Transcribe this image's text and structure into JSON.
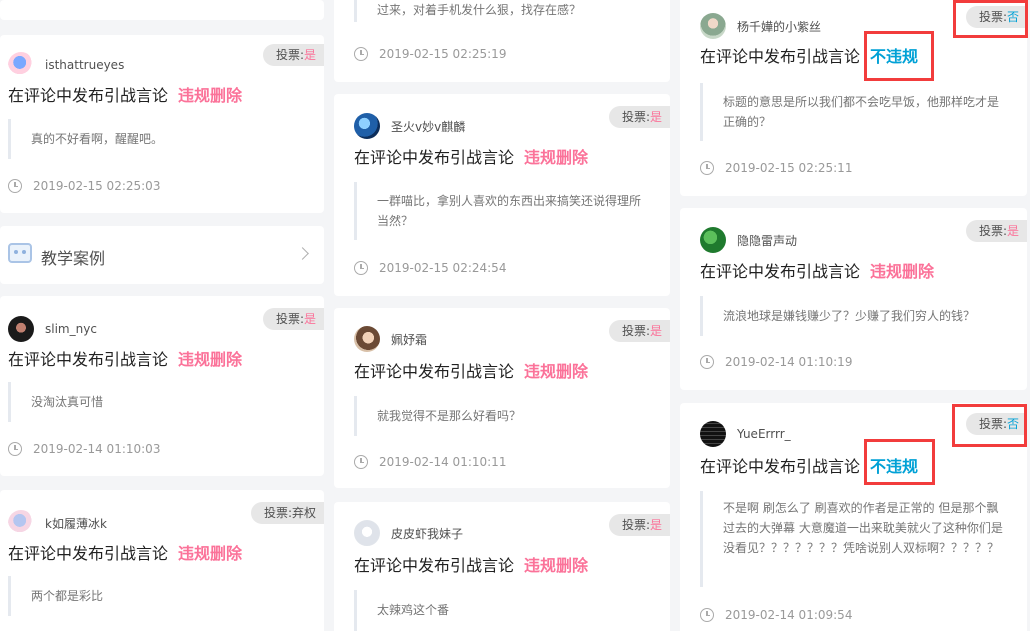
{
  "vote_prefix": "投票:",
  "menu": {
    "label": "教学案例"
  },
  "columns": [
    {
      "top_partial": {},
      "cards": [
        {
          "user": "isthattrueyes",
          "vote": "是",
          "reason": "在评论中发布引战言论",
          "verdict": "违规删除",
          "comment": "真的不好看啊，醒醒吧。",
          "time": "2019-02-15 02:25:03"
        },
        {
          "user": "slim_nyc",
          "vote": "是",
          "reason": "在评论中发布引战言论",
          "verdict": "违规删除",
          "comment": "没淘汰真可惜",
          "time": "2019-02-14 01:10:03"
        },
        {
          "user": "k如履薄冰k",
          "vote": "弃权",
          "reason": "在评论中发布引战言论",
          "verdict": "违规删除",
          "comment": "两个都是彩比",
          "time": ""
        }
      ]
    },
    {
      "top_partial": {
        "comment": "过来，对着手机发什么狠，找存在感？",
        "time": "2019-02-15 02:25:19"
      },
      "cards": [
        {
          "user": "圣火v妙v麒麟",
          "vote": "是",
          "reason": "在评论中发布引战言论",
          "verdict": "违规删除",
          "comment": "一群喵比，拿别人喜欢的东西出来搞笑还说得理所当然？",
          "time": "2019-02-15 02:24:54"
        },
        {
          "user": "姵妤霜",
          "vote": "是",
          "reason": "在评论中发布引战言论",
          "verdict": "违规删除",
          "comment": "就我觉得不是那么好看吗？",
          "time": "2019-02-14 01:10:11"
        },
        {
          "user": "皮皮虾我妹子",
          "vote": "是",
          "reason": "在评论中发布引战言论",
          "verdict": "违规删除",
          "comment": "太辣鸡这个番",
          "time": ""
        }
      ]
    },
    {
      "top_partial": {},
      "cards": [
        {
          "user": "杨千嬅的小紫丝",
          "vote": "否",
          "reason": "在评论中发布引战言论",
          "verdict": "不违规",
          "comment": "标题的意思是所以我们都不会吃早饭，他那样吃才是正确的？",
          "time": "2019-02-15 02:25:11"
        },
        {
          "user": "隐隐雷声动",
          "vote": "是",
          "reason": "在评论中发布引战言论",
          "verdict": "违规删除",
          "comment": "流浪地球是嫌钱赚少了？少赚了我们穷人的钱？",
          "time": "2019-02-14 01:10:19"
        },
        {
          "user": "YueErrrr_",
          "vote": "否",
          "reason": "在评论中发布引战言论",
          "verdict": "不违规",
          "comment": "不是啊 刷怎么了 刷喜欢的作者是正常的 但是那个飘过去的大弹幕 大意魔道一出来耽美就火了这种你们是没看见？？？？？？？凭啥说别人双标啊？？？？？",
          "time": "2019-02-14 01:09:54"
        }
      ]
    }
  ],
  "colors": {
    "pink": "#fb7299",
    "blue": "#00a1d6",
    "highlight": "#f23c3c"
  }
}
